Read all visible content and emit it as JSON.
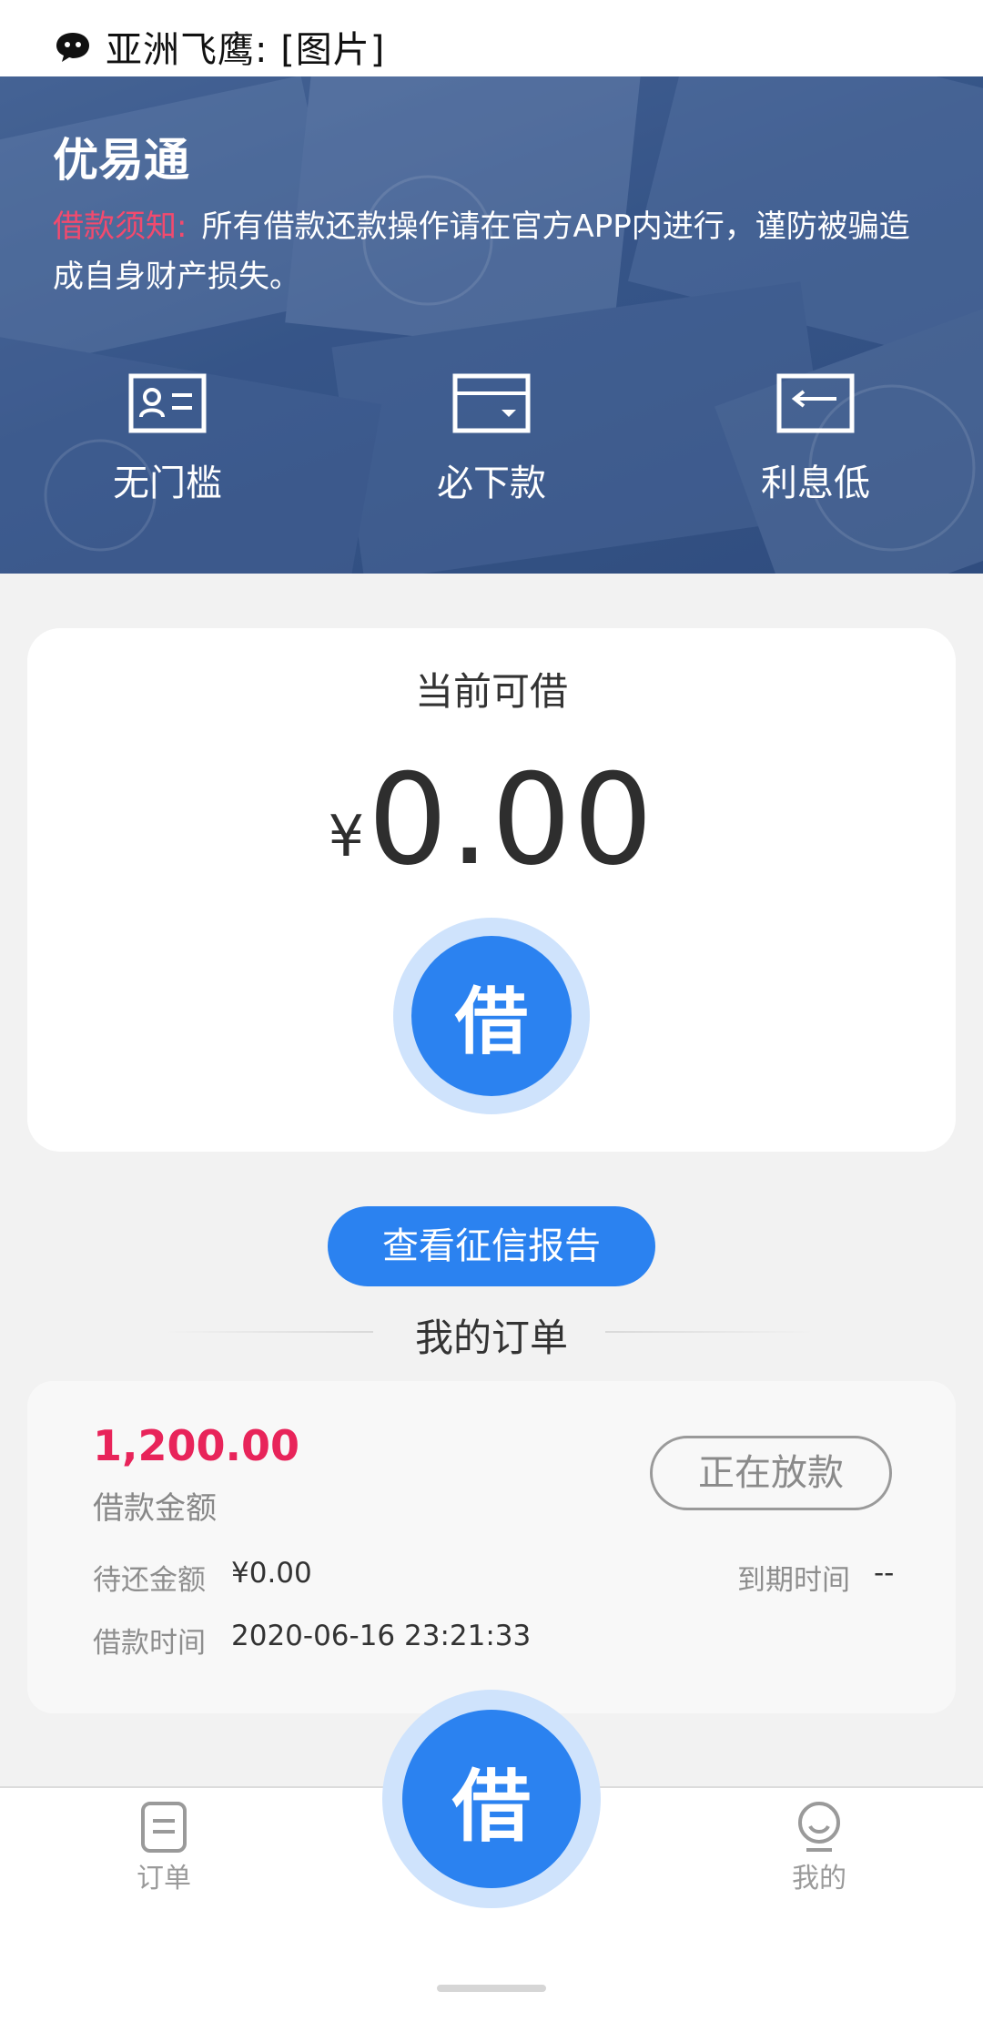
{
  "notification": {
    "text": "亚洲飞鹰: [图片]",
    "icon": "chat-bubble-icon"
  },
  "header": {
    "app_title": "优易通",
    "notice_label": "借款须知:",
    "notice_text": "所有借款还款操作请在官方APP内进行，谨防被骗造成自身财产损失。"
  },
  "features": [
    {
      "label": "无门槛",
      "icon": "id-card-icon"
    },
    {
      "label": "必下款",
      "icon": "wallet-icon"
    },
    {
      "label": "利息低",
      "icon": "return-screen-icon"
    }
  ],
  "available": {
    "caption": "当前可借",
    "currency": "¥",
    "amount": "0.00",
    "borrow_label": "借"
  },
  "credit_report_button": "查看征信报告",
  "orders": {
    "title": "我的订单",
    "items": [
      {
        "amount": "1,200.00",
        "amount_label": "借款金额",
        "status": "正在放款",
        "pending_label": "待还金额",
        "pending_value": "¥0.00",
        "due_label": "到期时间",
        "due_value": "--",
        "time_label": "借款时间",
        "time_value": "2020-06-16 23:21:33"
      }
    ]
  },
  "bottom_nav": {
    "orders_label": "订单",
    "fab_label": "借",
    "me_label": "我的"
  },
  "colors": {
    "accent_blue": "#2b82f0",
    "alert_red": "#e8245a",
    "notice_pink": "#f24a6e"
  }
}
